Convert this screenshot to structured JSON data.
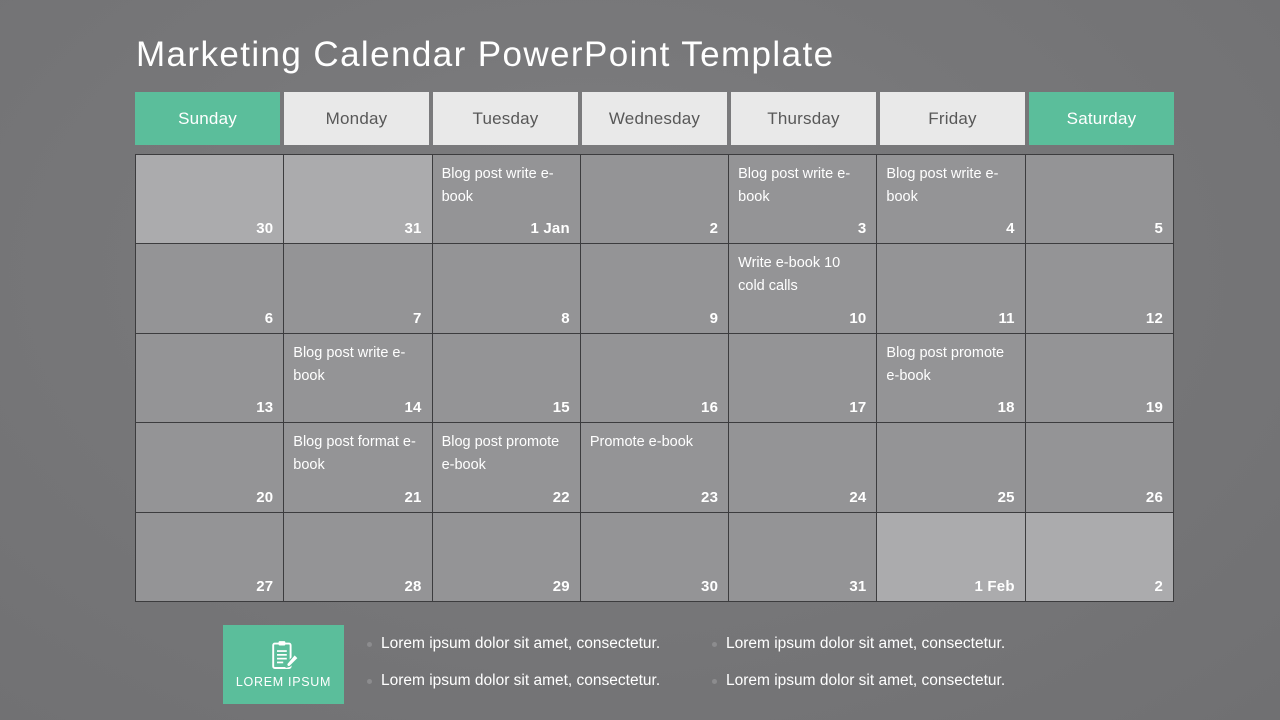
{
  "slide": {
    "title": "Marketing Calendar PowerPoint Template",
    "background_color": "#777779",
    "accent_color": "#5bbe9b"
  },
  "calendar": {
    "day_headers": [
      {
        "label": "Sunday",
        "style": "weekend"
      },
      {
        "label": "Monday",
        "style": "weekday"
      },
      {
        "label": "Tuesday",
        "style": "weekday"
      },
      {
        "label": "Wednesday",
        "style": "weekday"
      },
      {
        "label": "Thursday",
        "style": "weekday"
      },
      {
        "label": "Friday",
        "style": "weekday"
      },
      {
        "label": "Saturday",
        "style": "weekend"
      }
    ],
    "weeks": [
      [
        {
          "day": "30",
          "event": "",
          "in_month": false
        },
        {
          "day": "31",
          "event": "",
          "in_month": false
        },
        {
          "day": "1 Jan",
          "event": "Blog post write e-book",
          "in_month": true
        },
        {
          "day": "2",
          "event": "",
          "in_month": true
        },
        {
          "day": "3",
          "event": "Blog post write e-book",
          "in_month": true
        },
        {
          "day": "4",
          "event": "Blog post write e-book",
          "in_month": true
        },
        {
          "day": "5",
          "event": "",
          "in_month": true
        }
      ],
      [
        {
          "day": "6",
          "event": "",
          "in_month": true
        },
        {
          "day": "7",
          "event": "",
          "in_month": true
        },
        {
          "day": "8",
          "event": "",
          "in_month": true
        },
        {
          "day": "9",
          "event": "",
          "in_month": true
        },
        {
          "day": "10",
          "event": "Write e-book 10 cold calls",
          "in_month": true
        },
        {
          "day": "11",
          "event": "",
          "in_month": true
        },
        {
          "day": "12",
          "event": "",
          "in_month": true
        }
      ],
      [
        {
          "day": "13",
          "event": "",
          "in_month": true
        },
        {
          "day": "14",
          "event": "Blog post write e-book",
          "in_month": true
        },
        {
          "day": "15",
          "event": "",
          "in_month": true
        },
        {
          "day": "16",
          "event": "",
          "in_month": true
        },
        {
          "day": "17",
          "event": "",
          "in_month": true
        },
        {
          "day": "18",
          "event": "Blog post promote e-book",
          "in_month": true
        },
        {
          "day": "19",
          "event": "",
          "in_month": true
        }
      ],
      [
        {
          "day": "20",
          "event": "",
          "in_month": true
        },
        {
          "day": "21",
          "event": "Blog post format e-book",
          "in_month": true
        },
        {
          "day": "22",
          "event": "Blog post promote e-book",
          "in_month": true
        },
        {
          "day": "23",
          "event": "Promote e-book",
          "in_month": true
        },
        {
          "day": "24",
          "event": "",
          "in_month": true
        },
        {
          "day": "25",
          "event": "",
          "in_month": true
        },
        {
          "day": "26",
          "event": "",
          "in_month": true
        }
      ],
      [
        {
          "day": "27",
          "event": "",
          "in_month": true
        },
        {
          "day": "28",
          "event": "",
          "in_month": true
        },
        {
          "day": "29",
          "event": "",
          "in_month": true
        },
        {
          "day": "30",
          "event": "",
          "in_month": true
        },
        {
          "day": "31",
          "event": "",
          "in_month": true
        },
        {
          "day": "1 Feb",
          "event": "",
          "in_month": false
        },
        {
          "day": "2",
          "event": "",
          "in_month": false
        }
      ]
    ]
  },
  "footer": {
    "badge": {
      "icon": "clipboard-pencil-icon",
      "label": "LOREM IPSUM"
    },
    "bullets": [
      "Lorem ipsum dolor sit amet, consectetur.",
      "Lorem ipsum dolor sit amet, consectetur.",
      "Lorem ipsum dolor sit amet, consectetur.",
      "Lorem ipsum dolor sit amet, consectetur."
    ]
  }
}
